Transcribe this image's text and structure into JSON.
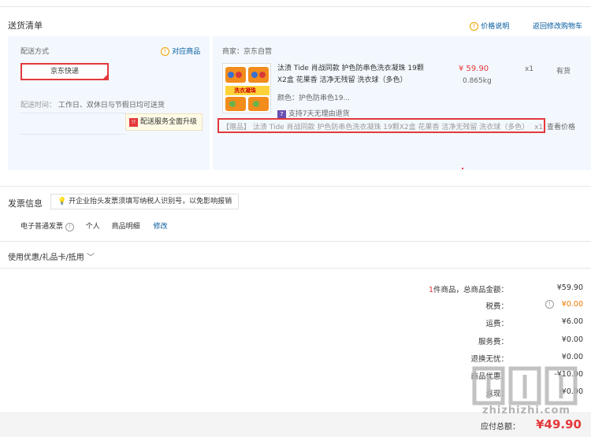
{
  "header": {
    "title": "送货清单",
    "price_note": "价格说明",
    "back_to_cart": "返回修改购物车"
  },
  "shipping": {
    "method_label": "配送方式",
    "matched_goods": "对应商品",
    "selected_method": "京东快递",
    "time_label": "配送时间：",
    "time_value": "工作日、双休日与节假日均可送货",
    "upgrade_badge": "!!!",
    "upgrade_text": "配送服务全面升级"
  },
  "merchant": {
    "label": "商家：京东自营"
  },
  "product": {
    "name": "汰渍 Tide 肖战同款 护色防串色洗衣凝珠 19颗X2盒 花果香 洁净无残留 洗衣球（多色）",
    "price": "¥ 59.90",
    "weight": "0.865kg",
    "qty": "x1",
    "stock": "有货",
    "color": "颜色：护色防串色19...",
    "return_badge": "7",
    "return_text": "支持7天无理由退货",
    "thumb_text": "洗衣凝珠"
  },
  "gift": {
    "text": "【赠品】  汰渍 Tide 肖战同款 护色防串色洗衣凝珠 19颗X2盒 花果香 洁净无残留 洗衣球（多色）",
    "qty": "x1",
    "view_price": "查看价格"
  },
  "invoice": {
    "title": "发票信息",
    "tip": "开企业抬头发票须填写纳税人识别号，以免影响报销",
    "type": "电子普通发票",
    "holder": "个人",
    "detail": "商品明细",
    "edit": "修改"
  },
  "coupon": {
    "title": "使用优惠/礼品卡/抵用"
  },
  "summary": {
    "count": "1",
    "count_suffix": "件商品，总商品金额：",
    "total_goods": "¥59.90",
    "tax_label": "税费：",
    "tax_value": "¥0.00",
    "freight_label": "运费：",
    "freight_value": "¥6.00",
    "service_label": "服务费：",
    "service_value": "¥0.00",
    "return_label": "退换无忧：",
    "return_value": "¥0.00",
    "discount_label": "商品优惠：",
    "discount_value": "-¥10.00",
    "extra_label": "返现：",
    "extra_value": "-¥0.00",
    "payable_label": "应付总额：",
    "payable_value": "¥49.90"
  },
  "watermark": {
    "logo": "值",
    "site": "zhizhizhi.com"
  },
  "colors": {
    "accent": "#e4393c",
    "link": "#005aa0",
    "panel": "#f3f8fe"
  }
}
